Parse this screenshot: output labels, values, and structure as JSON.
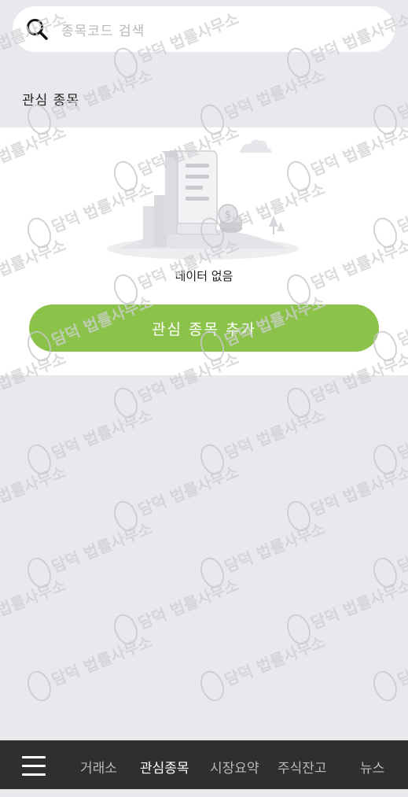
{
  "search": {
    "placeholder": "종목코드 검색",
    "icon": "search-icon"
  },
  "watchlist": {
    "title": "관심 종목",
    "empty_text": "데이터 없음",
    "add_button_label": "관심 종목 추가",
    "accent_color": "#8bc34a"
  },
  "watermark": {
    "text": "담덕 법률사무소"
  },
  "bottom_nav": {
    "menu_icon": "hamburger-menu-icon",
    "items": [
      {
        "label": "거래소",
        "active": false
      },
      {
        "label": "관심종목",
        "active": true
      },
      {
        "label": "시장요약",
        "active": false
      },
      {
        "label": "주식잔고",
        "active": false
      },
      {
        "label": "뉴스",
        "active": false
      }
    ]
  }
}
